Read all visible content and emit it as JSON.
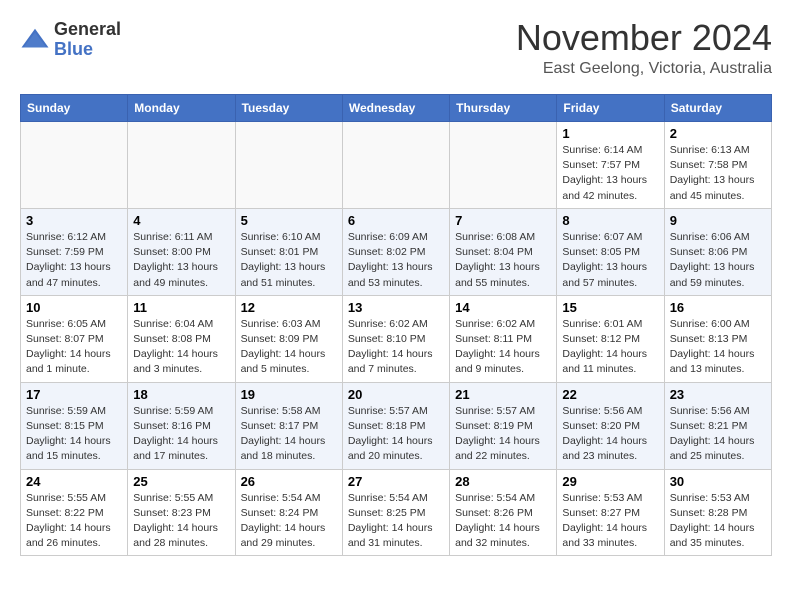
{
  "header": {
    "logo_line1": "General",
    "logo_line2": "Blue",
    "month": "November 2024",
    "location": "East Geelong, Victoria, Australia"
  },
  "weekdays": [
    "Sunday",
    "Monday",
    "Tuesday",
    "Wednesday",
    "Thursday",
    "Friday",
    "Saturday"
  ],
  "weeks": [
    [
      {
        "day": "",
        "info": ""
      },
      {
        "day": "",
        "info": ""
      },
      {
        "day": "",
        "info": ""
      },
      {
        "day": "",
        "info": ""
      },
      {
        "day": "",
        "info": ""
      },
      {
        "day": "1",
        "info": "Sunrise: 6:14 AM\nSunset: 7:57 PM\nDaylight: 13 hours\nand 42 minutes."
      },
      {
        "day": "2",
        "info": "Sunrise: 6:13 AM\nSunset: 7:58 PM\nDaylight: 13 hours\nand 45 minutes."
      }
    ],
    [
      {
        "day": "3",
        "info": "Sunrise: 6:12 AM\nSunset: 7:59 PM\nDaylight: 13 hours\nand 47 minutes."
      },
      {
        "day": "4",
        "info": "Sunrise: 6:11 AM\nSunset: 8:00 PM\nDaylight: 13 hours\nand 49 minutes."
      },
      {
        "day": "5",
        "info": "Sunrise: 6:10 AM\nSunset: 8:01 PM\nDaylight: 13 hours\nand 51 minutes."
      },
      {
        "day": "6",
        "info": "Sunrise: 6:09 AM\nSunset: 8:02 PM\nDaylight: 13 hours\nand 53 minutes."
      },
      {
        "day": "7",
        "info": "Sunrise: 6:08 AM\nSunset: 8:04 PM\nDaylight: 13 hours\nand 55 minutes."
      },
      {
        "day": "8",
        "info": "Sunrise: 6:07 AM\nSunset: 8:05 PM\nDaylight: 13 hours\nand 57 minutes."
      },
      {
        "day": "9",
        "info": "Sunrise: 6:06 AM\nSunset: 8:06 PM\nDaylight: 13 hours\nand 59 minutes."
      }
    ],
    [
      {
        "day": "10",
        "info": "Sunrise: 6:05 AM\nSunset: 8:07 PM\nDaylight: 14 hours\nand 1 minute."
      },
      {
        "day": "11",
        "info": "Sunrise: 6:04 AM\nSunset: 8:08 PM\nDaylight: 14 hours\nand 3 minutes."
      },
      {
        "day": "12",
        "info": "Sunrise: 6:03 AM\nSunset: 8:09 PM\nDaylight: 14 hours\nand 5 minutes."
      },
      {
        "day": "13",
        "info": "Sunrise: 6:02 AM\nSunset: 8:10 PM\nDaylight: 14 hours\nand 7 minutes."
      },
      {
        "day": "14",
        "info": "Sunrise: 6:02 AM\nSunset: 8:11 PM\nDaylight: 14 hours\nand 9 minutes."
      },
      {
        "day": "15",
        "info": "Sunrise: 6:01 AM\nSunset: 8:12 PM\nDaylight: 14 hours\nand 11 minutes."
      },
      {
        "day": "16",
        "info": "Sunrise: 6:00 AM\nSunset: 8:13 PM\nDaylight: 14 hours\nand 13 minutes."
      }
    ],
    [
      {
        "day": "17",
        "info": "Sunrise: 5:59 AM\nSunset: 8:15 PM\nDaylight: 14 hours\nand 15 minutes."
      },
      {
        "day": "18",
        "info": "Sunrise: 5:59 AM\nSunset: 8:16 PM\nDaylight: 14 hours\nand 17 minutes."
      },
      {
        "day": "19",
        "info": "Sunrise: 5:58 AM\nSunset: 8:17 PM\nDaylight: 14 hours\nand 18 minutes."
      },
      {
        "day": "20",
        "info": "Sunrise: 5:57 AM\nSunset: 8:18 PM\nDaylight: 14 hours\nand 20 minutes."
      },
      {
        "day": "21",
        "info": "Sunrise: 5:57 AM\nSunset: 8:19 PM\nDaylight: 14 hours\nand 22 minutes."
      },
      {
        "day": "22",
        "info": "Sunrise: 5:56 AM\nSunset: 8:20 PM\nDaylight: 14 hours\nand 23 minutes."
      },
      {
        "day": "23",
        "info": "Sunrise: 5:56 AM\nSunset: 8:21 PM\nDaylight: 14 hours\nand 25 minutes."
      }
    ],
    [
      {
        "day": "24",
        "info": "Sunrise: 5:55 AM\nSunset: 8:22 PM\nDaylight: 14 hours\nand 26 minutes."
      },
      {
        "day": "25",
        "info": "Sunrise: 5:55 AM\nSunset: 8:23 PM\nDaylight: 14 hours\nand 28 minutes."
      },
      {
        "day": "26",
        "info": "Sunrise: 5:54 AM\nSunset: 8:24 PM\nDaylight: 14 hours\nand 29 minutes."
      },
      {
        "day": "27",
        "info": "Sunrise: 5:54 AM\nSunset: 8:25 PM\nDaylight: 14 hours\nand 31 minutes."
      },
      {
        "day": "28",
        "info": "Sunrise: 5:54 AM\nSunset: 8:26 PM\nDaylight: 14 hours\nand 32 minutes."
      },
      {
        "day": "29",
        "info": "Sunrise: 5:53 AM\nSunset: 8:27 PM\nDaylight: 14 hours\nand 33 minutes."
      },
      {
        "day": "30",
        "info": "Sunrise: 5:53 AM\nSunset: 8:28 PM\nDaylight: 14 hours\nand 35 minutes."
      }
    ]
  ]
}
